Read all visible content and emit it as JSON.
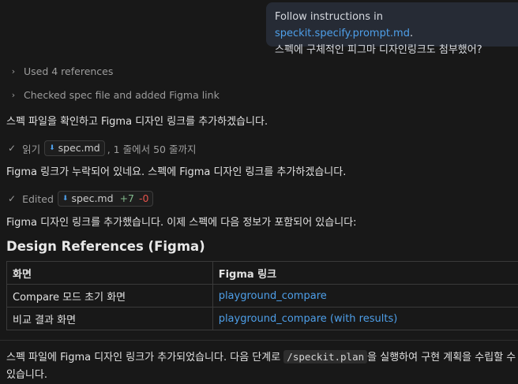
{
  "user_message": {
    "prefix": "Follow instructions in ",
    "link": "speckit.specify.prompt.md",
    "suffix": ".",
    "line2": "스펙에 구체적인 피그마 디자인링크도 첨부했어?"
  },
  "steps": {
    "references": "Used 4 references",
    "checked": "Checked spec file and added Figma link"
  },
  "para1": "스펙 파일을 확인하고 Figma 디자인 링크를 추가하겠습니다.",
  "read": {
    "label": "읽기",
    "file": "spec.md",
    "suffix": ", 1 줄에서 50 줄까지"
  },
  "para2": "Figma 링크가 누락되어 있네요. 스펙에 Figma 디자인 링크를 추가하겠습니다.",
  "edited": {
    "label": "Edited",
    "file": "spec.md",
    "plus": "+7",
    "minus": "-0"
  },
  "para3": "Figma 디자인 링크를 추가했습니다. 이제 스펙에 다음 정보가 포함되어 있습니다:",
  "section_title": "Design References (Figma)",
  "table": {
    "headers": [
      "화면",
      "Figma 링크"
    ],
    "rows": [
      [
        "Compare 모드 초기 화면",
        "playground_compare"
      ],
      [
        "비교 결과 화면",
        "playground_compare (with results)"
      ]
    ]
  },
  "final": {
    "before": "스펙 파일에 Figma 디자인 링크가 추가되었습니다. 다음 단계로 ",
    "code": "/speckit.plan",
    "after": "을 실행하여 구현 계획을 수립할 수 있습니다."
  },
  "icons": {
    "chevron": "chevron-right-icon",
    "check": "check-icon",
    "file": "markdown-file-icon"
  }
}
